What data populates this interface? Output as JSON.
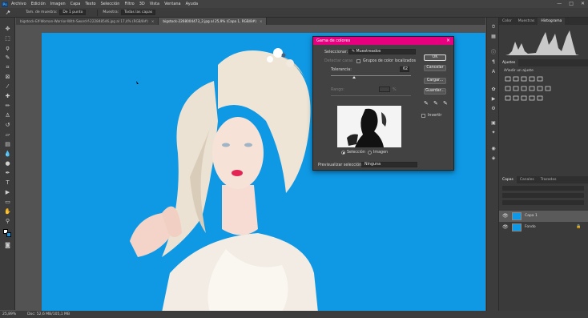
{
  "menubar": {
    "logo": "Ps",
    "items": [
      "Archivo",
      "Edición",
      "Imagen",
      "Capa",
      "Texto",
      "Selección",
      "Filtro",
      "3D",
      "Vista",
      "Ventana",
      "Ayuda"
    ],
    "win_min": "—",
    "win_max": "□",
    "win_close": "✕"
  },
  "options": {
    "sample_label": "Tam. de muestra:",
    "sample_value": "De 1 punto",
    "sample_from_label": "Muestra:",
    "sample_from_value": "Todas las capas"
  },
  "tabs": [
    {
      "label": "bigstock-Elf-Woman-Warrior-With-Sword-f-222848546.jpg al 17,4% (RGB/8#)",
      "active": false
    },
    {
      "label": "bigstock-2268004473_2.jpg al 25,9% (Capa 1, RGB/8#)",
      "active": true
    }
  ],
  "tab_close": "×",
  "status": {
    "zoom": "25,89%",
    "doc": "Doc: 52,6 MB/105,1 MB"
  },
  "right_panels": {
    "top_tabs": [
      "Color",
      "Muestras",
      "Histograma"
    ],
    "adjust_tabs": [
      "Ajustes"
    ],
    "adjust_hint": "Añadir un ajuste",
    "layers_tabs": [
      "Capas",
      "Canales",
      "Trazados"
    ],
    "layers": [
      {
        "name": "Capa 1",
        "selected": true
      },
      {
        "name": "Fondo",
        "selected": false
      }
    ],
    "lock_icon": "🔒"
  },
  "dialog": {
    "title": "Gama de colores",
    "select_label": "Seleccionar:",
    "select_value": "Muestreados",
    "detect_faces": "Detectar caras",
    "localized": "Grupos de color localizados",
    "tolerance_label": "Tolerancia:",
    "tolerance_value": "62",
    "range_label": "Rango:",
    "range_unit": "%",
    "radio_selection": "Selección",
    "radio_image": "Imagen",
    "preview_label": "Previsualizar selección:",
    "preview_value": "Ninguna",
    "ok": "OK",
    "cancel": "Cancelar",
    "load": "Cargar...",
    "save": "Guardar...",
    "invert": "Invertir",
    "close": "×"
  },
  "colors": {
    "canvas_bg": "#0f98e3",
    "dialog_title": "#e6007f",
    "panel_bg": "#3a3a3a",
    "workspace": "#535353"
  }
}
